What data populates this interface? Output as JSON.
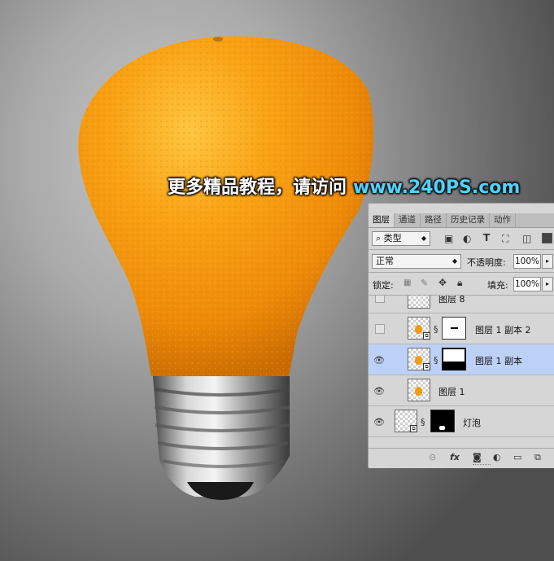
{
  "watermark": {
    "text": "更多精品教程，请访问",
    "url": "www.240PS.com"
  },
  "panel": {
    "tabs": [
      "图层",
      "通道",
      "路径",
      "历史记录",
      "动作"
    ],
    "active_tab": "图层",
    "filter_type": "类型",
    "blend_mode": "正常",
    "opacity_label": "不透明度:",
    "opacity_value": "100%",
    "lock_label": "锁定:",
    "fill_label": "填充:",
    "fill_value": "100%",
    "layers": [
      {
        "name": "图层 8",
        "visible": false,
        "selected": false,
        "has_mask": false,
        "linked_smart": false
      },
      {
        "name": "图层 1 副本 2",
        "visible": false,
        "selected": false,
        "has_mask": true,
        "mask": "line"
      },
      {
        "name": "图层 1 副本",
        "visible": true,
        "selected": true,
        "has_mask": true,
        "mask": "bottom-black"
      },
      {
        "name": "图层 1",
        "visible": true,
        "selected": false,
        "has_mask": false
      },
      {
        "name": "灯泡",
        "visible": true,
        "selected": false,
        "has_mask": true,
        "mask": "black"
      }
    ],
    "icons": [
      "link-icon",
      "fx-icon",
      "mask-icon",
      "adjustment-icon",
      "folder-icon",
      "new-layer-icon"
    ],
    "fx_label": "fx"
  },
  "colors": {
    "orange": "#f39a12",
    "selection": "#bdd1f7",
    "url": "#4fd3ff"
  }
}
